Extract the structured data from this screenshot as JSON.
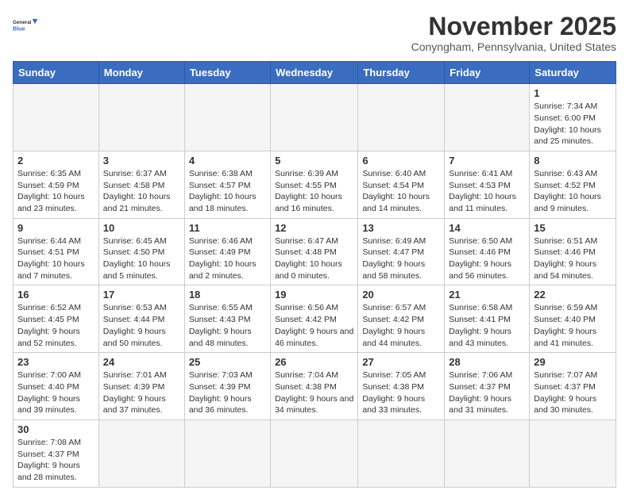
{
  "logo": {
    "line1": "General",
    "line2": "Blue"
  },
  "title": "November 2025",
  "subtitle": "Conyngham, Pennsylvania, United States",
  "days_of_week": [
    "Sunday",
    "Monday",
    "Tuesday",
    "Wednesday",
    "Thursday",
    "Friday",
    "Saturday"
  ],
  "weeks": [
    [
      {
        "day": "",
        "info": "",
        "empty": true
      },
      {
        "day": "",
        "info": "",
        "empty": true
      },
      {
        "day": "",
        "info": "",
        "empty": true
      },
      {
        "day": "",
        "info": "",
        "empty": true
      },
      {
        "day": "",
        "info": "",
        "empty": true
      },
      {
        "day": "",
        "info": "",
        "empty": true
      },
      {
        "day": "1",
        "info": "Sunrise: 7:34 AM\nSunset: 6:00 PM\nDaylight: 10 hours and 25 minutes.",
        "empty": false
      }
    ],
    [
      {
        "day": "2",
        "info": "Sunrise: 6:35 AM\nSunset: 4:59 PM\nDaylight: 10 hours and 23 minutes.",
        "empty": false
      },
      {
        "day": "3",
        "info": "Sunrise: 6:37 AM\nSunset: 4:58 PM\nDaylight: 10 hours and 21 minutes.",
        "empty": false
      },
      {
        "day": "4",
        "info": "Sunrise: 6:38 AM\nSunset: 4:57 PM\nDaylight: 10 hours and 18 minutes.",
        "empty": false
      },
      {
        "day": "5",
        "info": "Sunrise: 6:39 AM\nSunset: 4:55 PM\nDaylight: 10 hours and 16 minutes.",
        "empty": false
      },
      {
        "day": "6",
        "info": "Sunrise: 6:40 AM\nSunset: 4:54 PM\nDaylight: 10 hours and 14 minutes.",
        "empty": false
      },
      {
        "day": "7",
        "info": "Sunrise: 6:41 AM\nSunset: 4:53 PM\nDaylight: 10 hours and 11 minutes.",
        "empty": false
      },
      {
        "day": "8",
        "info": "Sunrise: 6:43 AM\nSunset: 4:52 PM\nDaylight: 10 hours and 9 minutes.",
        "empty": false
      }
    ],
    [
      {
        "day": "9",
        "info": "Sunrise: 6:44 AM\nSunset: 4:51 PM\nDaylight: 10 hours and 7 minutes.",
        "empty": false
      },
      {
        "day": "10",
        "info": "Sunrise: 6:45 AM\nSunset: 4:50 PM\nDaylight: 10 hours and 5 minutes.",
        "empty": false
      },
      {
        "day": "11",
        "info": "Sunrise: 6:46 AM\nSunset: 4:49 PM\nDaylight: 10 hours and 2 minutes.",
        "empty": false
      },
      {
        "day": "12",
        "info": "Sunrise: 6:47 AM\nSunset: 4:48 PM\nDaylight: 10 hours and 0 minutes.",
        "empty": false
      },
      {
        "day": "13",
        "info": "Sunrise: 6:49 AM\nSunset: 4:47 PM\nDaylight: 9 hours and 58 minutes.",
        "empty": false
      },
      {
        "day": "14",
        "info": "Sunrise: 6:50 AM\nSunset: 4:46 PM\nDaylight: 9 hours and 56 minutes.",
        "empty": false
      },
      {
        "day": "15",
        "info": "Sunrise: 6:51 AM\nSunset: 4:46 PM\nDaylight: 9 hours and 54 minutes.",
        "empty": false
      }
    ],
    [
      {
        "day": "16",
        "info": "Sunrise: 6:52 AM\nSunset: 4:45 PM\nDaylight: 9 hours and 52 minutes.",
        "empty": false
      },
      {
        "day": "17",
        "info": "Sunrise: 6:53 AM\nSunset: 4:44 PM\nDaylight: 9 hours and 50 minutes.",
        "empty": false
      },
      {
        "day": "18",
        "info": "Sunrise: 6:55 AM\nSunset: 4:43 PM\nDaylight: 9 hours and 48 minutes.",
        "empty": false
      },
      {
        "day": "19",
        "info": "Sunrise: 6:56 AM\nSunset: 4:42 PM\nDaylight: 9 hours and 46 minutes.",
        "empty": false
      },
      {
        "day": "20",
        "info": "Sunrise: 6:57 AM\nSunset: 4:42 PM\nDaylight: 9 hours and 44 minutes.",
        "empty": false
      },
      {
        "day": "21",
        "info": "Sunrise: 6:58 AM\nSunset: 4:41 PM\nDaylight: 9 hours and 43 minutes.",
        "empty": false
      },
      {
        "day": "22",
        "info": "Sunrise: 6:59 AM\nSunset: 4:40 PM\nDaylight: 9 hours and 41 minutes.",
        "empty": false
      }
    ],
    [
      {
        "day": "23",
        "info": "Sunrise: 7:00 AM\nSunset: 4:40 PM\nDaylight: 9 hours and 39 minutes.",
        "empty": false
      },
      {
        "day": "24",
        "info": "Sunrise: 7:01 AM\nSunset: 4:39 PM\nDaylight: 9 hours and 37 minutes.",
        "empty": false
      },
      {
        "day": "25",
        "info": "Sunrise: 7:03 AM\nSunset: 4:39 PM\nDaylight: 9 hours and 36 minutes.",
        "empty": false
      },
      {
        "day": "26",
        "info": "Sunrise: 7:04 AM\nSunset: 4:38 PM\nDaylight: 9 hours and 34 minutes.",
        "empty": false
      },
      {
        "day": "27",
        "info": "Sunrise: 7:05 AM\nSunset: 4:38 PM\nDaylight: 9 hours and 33 minutes.",
        "empty": false
      },
      {
        "day": "28",
        "info": "Sunrise: 7:06 AM\nSunset: 4:37 PM\nDaylight: 9 hours and 31 minutes.",
        "empty": false
      },
      {
        "day": "29",
        "info": "Sunrise: 7:07 AM\nSunset: 4:37 PM\nDaylight: 9 hours and 30 minutes.",
        "empty": false
      }
    ],
    [
      {
        "day": "30",
        "info": "Sunrise: 7:08 AM\nSunset: 4:37 PM\nDaylight: 9 hours and 28 minutes.",
        "empty": false
      },
      {
        "day": "",
        "info": "",
        "empty": true
      },
      {
        "day": "",
        "info": "",
        "empty": true
      },
      {
        "day": "",
        "info": "",
        "empty": true
      },
      {
        "day": "",
        "info": "",
        "empty": true
      },
      {
        "day": "",
        "info": "",
        "empty": true
      },
      {
        "day": "",
        "info": "",
        "empty": true
      }
    ]
  ]
}
